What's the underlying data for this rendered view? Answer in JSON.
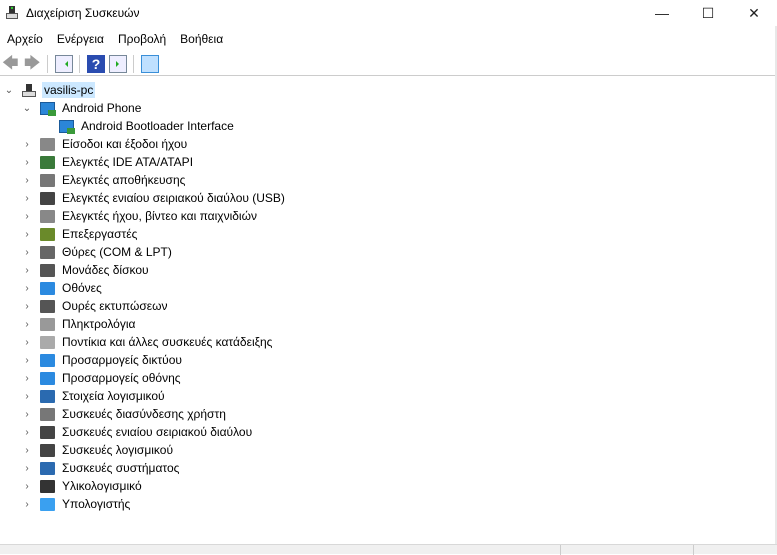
{
  "window": {
    "title": "Διαχείριση Συσκευών"
  },
  "menu": [
    "Αρχείο",
    "Ενέργεια",
    "Προβολή",
    "Βοήθεια"
  ],
  "tree": {
    "root": "vasilis-pc",
    "expanded": {
      "label": "Android Phone",
      "children": [
        "Android Bootloader Interface"
      ]
    },
    "categories": [
      {
        "label": "Είσοδοι και έξοδοι ήχου",
        "icon": "speaker-icon"
      },
      {
        "label": "Ελεγκτές IDE ATA/ATAPI",
        "icon": "ide-controller-icon"
      },
      {
        "label": "Ελεγκτές αποθήκευσης",
        "icon": "storage-controller-icon"
      },
      {
        "label": "Ελεγκτές ενιαίου σειριακού διαύλου (USB)",
        "icon": "usb-icon"
      },
      {
        "label": "Ελεγκτές ήχου, βίντεο και παιχνιδιών",
        "icon": "speaker-icon"
      },
      {
        "label": "Επεξεργαστές",
        "icon": "processor-icon"
      },
      {
        "label": "Θύρες (COM & LPT)",
        "icon": "port-icon"
      },
      {
        "label": "Μονάδες δίσκου",
        "icon": "disk-drive-icon"
      },
      {
        "label": "Οθόνες",
        "icon": "monitor-icon"
      },
      {
        "label": "Ουρές εκτυπώσεων",
        "icon": "printer-icon"
      },
      {
        "label": "Πληκτρολόγια",
        "icon": "keyboard-icon"
      },
      {
        "label": "Ποντίκια και άλλες συσκευές κατάδειξης",
        "icon": "mouse-icon"
      },
      {
        "label": "Προσαρμογείς δικτύου",
        "icon": "network-adapter-icon"
      },
      {
        "label": "Προσαρμογείς οθόνης",
        "icon": "display-adapter-icon"
      },
      {
        "label": "Στοιχεία λογισμικού",
        "icon": "software-component-icon"
      },
      {
        "label": "Συσκευές διασύνδεσης χρήστη",
        "icon": "hid-icon"
      },
      {
        "label": "Συσκευές ενιαίου σειριακού διαύλου",
        "icon": "usb-icon"
      },
      {
        "label": "Συσκευές λογισμικού",
        "icon": "software-device-icon"
      },
      {
        "label": "Συσκευές συστήματος",
        "icon": "system-device-icon"
      },
      {
        "label": "Υλικολογισμικό",
        "icon": "firmware-icon"
      },
      {
        "label": "Υπολογιστής",
        "icon": "computer-icon"
      }
    ]
  }
}
